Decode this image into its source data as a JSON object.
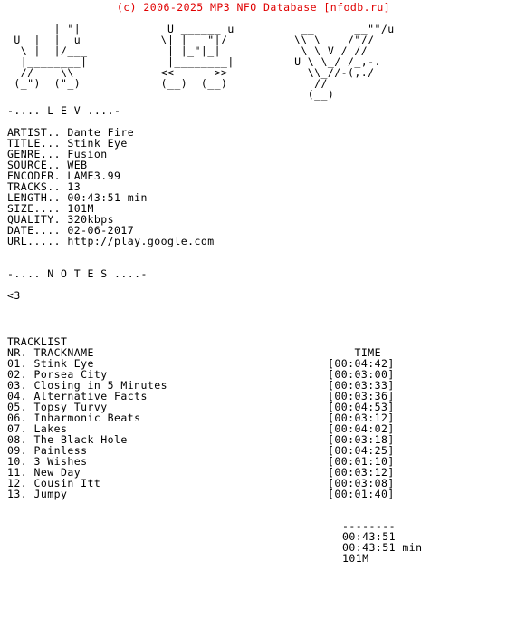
{
  "header": {
    "copyright_line": "(c) 2006-2025 MP3 NFO Database [nfodb.ru]",
    "copyright_color": "#e00000"
  },
  "ascii_art": {
    "description": "ASCII logo art for LEV group",
    "lines": [
      "            _                                                 ",
      "         | \"|            U ______ u        __      __ \"\"/u    ",
      "  U  | | |  u          \\| |   \"|/       \\\\  \\    /\"/        ",
      "   \\| |/___            | |_\"| |          \\/\\ V /\\/          ",
      "    |______|            | |___| |        U /  \\ u           ",
      "    //  \\\\            <<   >>             \\_/ \\_/-,-.      ",
      "   (_\")(\"_)           (__) (__)            //  \\\\           ",
      "                                           (__)(__)           "
    ],
    "raw": [
      "             _",
      "   U  |  |  u",
      "     \\ |  |/",
      "      |____|",
      "      //  \\\\",
      "    (_\")(\"_)"
    ]
  },
  "sections": {
    "lev_title": "-.... L E V ....-",
    "notes_title": "-.... N O T E S ....-",
    "notes_body": "<3"
  },
  "metadata": {
    "rows": [
      {
        "label": "ARTIST..",
        "value": "Dante Fire"
      },
      {
        "label": "TITLE...",
        "value": "Stink Eye"
      },
      {
        "label": "GENRE...",
        "value": "Fusion"
      },
      {
        "label": "SOURCE..",
        "value": "WEB"
      },
      {
        "label": "ENCODER.",
        "value": "LAME3.99"
      },
      {
        "label": "TRACKS..",
        "value": "13"
      },
      {
        "label": "LENGTH..",
        "value": "00:43:51 min"
      },
      {
        "label": "SIZE....",
        "value": "101M"
      },
      {
        "label": "QUALITY.",
        "value": "320kbps"
      },
      {
        "label": "DATE....",
        "value": "02-06-2017"
      },
      {
        "label": "URL.....",
        "value": "http://play.google.com"
      }
    ]
  },
  "tracklist": {
    "title": "TRACKLIST",
    "col_nr": "NR.",
    "col_trackname": "TRACKNAME",
    "col_time": "TIME",
    "tracks": [
      {
        "nr": "01.",
        "name": "Stink Eye",
        "time": "[00:04:42]"
      },
      {
        "nr": "02.",
        "name": "Porsea City",
        "time": "[00:03:00]"
      },
      {
        "nr": "03.",
        "name": "Closing in 5 Minutes",
        "time": "[00:03:33]"
      },
      {
        "nr": "04.",
        "name": "Alternative Facts",
        "time": "[00:03:36]"
      },
      {
        "nr": "05.",
        "name": "Topsy Turvy",
        "time": "[00:04:53]"
      },
      {
        "nr": "06.",
        "name": "Inharmonic Beats",
        "time": "[00:03:12]"
      },
      {
        "nr": "07.",
        "name": "Lakes",
        "time": "[00:04:02]"
      },
      {
        "nr": "08.",
        "name": "The Black Hole",
        "time": "[00:03:18]"
      },
      {
        "nr": "09.",
        "name": "Painless",
        "time": "[00:04:25]"
      },
      {
        "nr": "10.",
        "name": "3 Wishes",
        "time": "[00:01:10]"
      },
      {
        "nr": "11.",
        "name": "New Day",
        "time": "[00:03:12]"
      },
      {
        "nr": "12.",
        "name": "Cousin Itt",
        "time": "[00:03:08]"
      },
      {
        "nr": "13.",
        "name": "Jumpy",
        "time": "[00:01:40]"
      }
    ]
  },
  "totals": {
    "divider": "--------",
    "total_time": "00:43:51",
    "total_time_labeled": "00:43:51 min",
    "total_size": "101M"
  }
}
